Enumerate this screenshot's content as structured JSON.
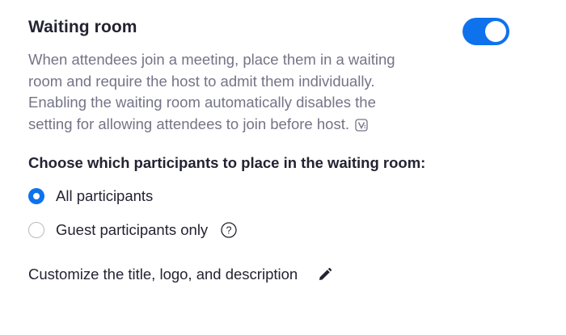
{
  "waiting_room": {
    "title": "Waiting room",
    "enabled": true,
    "accent_color": "#0e72ed",
    "description_lines": [
      "When attendees join a meeting, place them in a waiting",
      "room and require the host to admit them individually.",
      "Enabling the waiting room automatically disables the",
      "setting for allowing attendees to join before host."
    ],
    "description_icon": "v-badge-icon"
  },
  "participants": {
    "heading": "Choose which participants to place in the waiting room:",
    "options": [
      {
        "label": "All participants",
        "selected": true
      },
      {
        "label": "Guest participants only",
        "selected": false,
        "help_icon": "help-icon"
      }
    ]
  },
  "customize": {
    "label": "Customize the title, logo, and description",
    "icon": "pencil-icon"
  }
}
